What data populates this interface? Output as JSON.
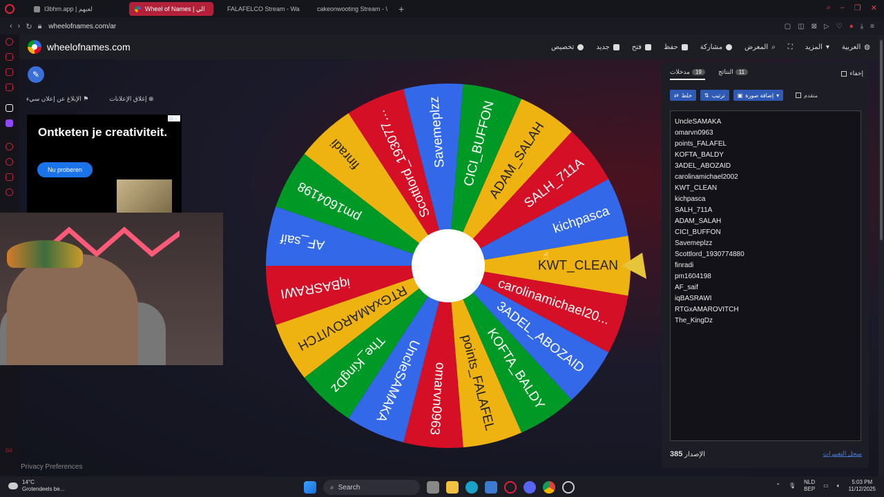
{
  "browser": {
    "tabs": [
      {
        "label": "I3bhm.app | لعبهم",
        "active": false
      },
      {
        "label": "Wheel of Names | الي",
        "active": true
      },
      {
        "label": "FALAFELCO Stream - Wa",
        "active": false
      },
      {
        "label": "cakeonwooting Stream - \\",
        "active": false
      }
    ],
    "url": "wheelofnames.com/ar"
  },
  "site": {
    "name": "wheelofnames.com",
    "menu": [
      "تخصيص",
      "جديد",
      "فتح",
      "حفظ",
      "مشاركة",
      "المعرض",
      "المزيد",
      "العربية"
    ]
  },
  "left": {
    "report_ad": "الإبلاغ عن إعلان سيء",
    "close_ads": "إغلاق الإعلانات",
    "ad_headline": "Ontketen je creativiteit.",
    "ad_button": "Nu proberen",
    "privacy": "Privacy Preferences"
  },
  "wheel": {
    "entries": [
      "KWT_CLEAN",
      "carolinamichael20...",
      "3ADEL_ABOZAID",
      "KOFTA_BALDY",
      "points_FALAFEL",
      "omarvn0963",
      "UncleSAMAKA",
      "The_KingDz",
      "RTGxAMAROVITCH",
      "iqBASRAWI",
      "AF_saif",
      "pm1604198",
      "finradi",
      "Scottlord_193077…",
      "Savemeplzz",
      "CICI_BUFFON",
      "ADAM_SALAH",
      "SALH_711A",
      "kichpasca"
    ],
    "colors": [
      "#eeb211",
      "#d50f25",
      "#3369e8",
      "#009925"
    ]
  },
  "panel": {
    "tab_entries": "مدخلات",
    "entries_count": "19",
    "tab_results": "النتائج",
    "results_count": "11",
    "hide_label": "إخفاء",
    "shuffle": "خلط",
    "sort": "ترتيب",
    "add_image": "إضافة صورة",
    "advanced": "متقدم",
    "entries": [
      "UncleSAMAKA",
      "omarvn0963",
      "points_FALAFEL",
      "KOFTA_BALDY",
      "3ADEL_ABOZAID",
      "carolinamichael2002",
      "KWT_CLEAN",
      "kichpasca",
      "SALH_711A",
      "ADAM_SALAH",
      "CICI_BUFFON",
      "Savemeplzz",
      "Scottlord_1930774880",
      "finradi",
      "pm1604198",
      "AF_saif",
      "iqBASRAWI",
      "RTGxAMAROVITCH",
      "The_KingDz"
    ],
    "version_label": "الإصدار",
    "version": "385",
    "changelog": "سجل التغييرات"
  },
  "taskbar": {
    "temp": "14°C",
    "weather": "Grotendeels be...",
    "search": "Search",
    "lang": "NLD",
    "region": "BEP",
    "time": "5:03 PM",
    "date": "11/12/2025"
  }
}
